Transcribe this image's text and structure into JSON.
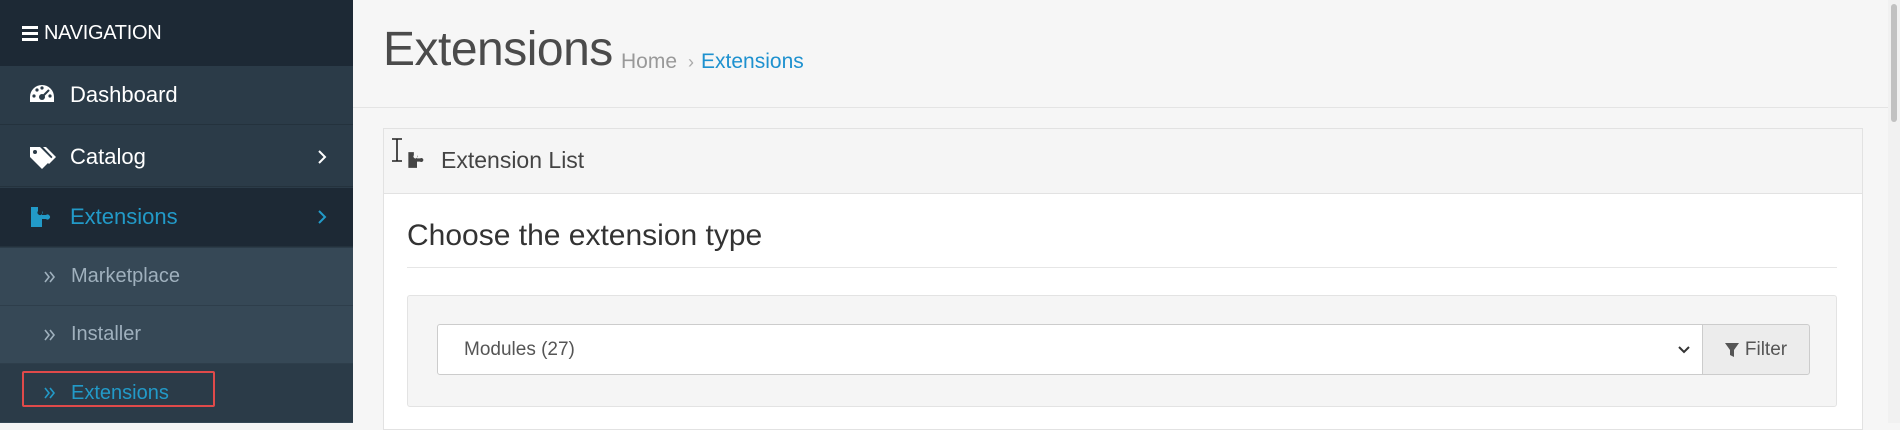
{
  "sidebar": {
    "header_label": "NAVIGATION",
    "items": [
      {
        "label": "Dashboard",
        "icon": "dashboard-icon"
      },
      {
        "label": "Catalog",
        "icon": "tags-icon"
      },
      {
        "label": "Extensions",
        "icon": "puzzle-icon",
        "active": true
      }
    ],
    "submenu": [
      {
        "label": "Marketplace"
      },
      {
        "label": "Installer"
      },
      {
        "label": "Extensions",
        "active": true
      }
    ]
  },
  "header": {
    "title": "Extensions",
    "breadcrumb": {
      "home": "Home",
      "current": "Extensions"
    }
  },
  "panel": {
    "title": "Extension List",
    "section_title": "Choose the extension type",
    "select_value": "Modules (27)",
    "filter_label": "Filter"
  },
  "colors": {
    "sidebar_bg": "#2b3b48",
    "nav_header_bg": "#1d2935",
    "accent": "#229ac8",
    "highlight": "#e04a4a"
  }
}
